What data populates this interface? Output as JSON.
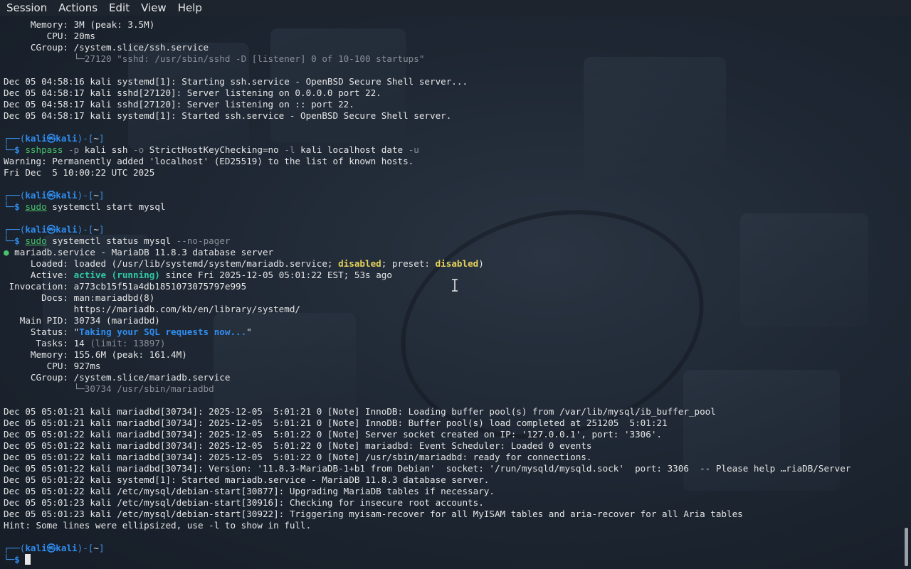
{
  "menu": [
    "Session",
    "Actions",
    "Edit",
    "View",
    "Help"
  ],
  "prompt": {
    "open": "┌──(",
    "user": "kali",
    "at": "㉿",
    "host": "kali",
    "mid": ")-[",
    "dir": "~",
    "close": "]",
    "arrow": "└─",
    "dollar": "$ "
  },
  "lines": [
    {
      "t": "     Memory: 3M (peak: 3.5M)"
    },
    {
      "t": "        CPU: 20ms"
    },
    {
      "t": "     CGroup: /system.slice/ssh.service"
    },
    {
      "t": "             └─27120 \"sshd: /usr/sbin/sshd -D [listener] 0 of 10-100 startups\"",
      "cls": "gray",
      "pre": "             └─"
    },
    {
      "t": ""
    },
    {
      "t": "Dec 05 04:58:16 kali systemd[1]: Starting ssh.service - OpenBSD Secure Shell server..."
    },
    {
      "t": "Dec 05 04:58:17 kali sshd[27120]: Server listening on 0.0.0.0 port 22."
    },
    {
      "t": "Dec 05 04:58:17 kali sshd[27120]: Server listening on :: port 22."
    },
    {
      "t": "Dec 05 04:58:17 kali systemd[1]: Started ssh.service - OpenBSD Secure Shell server."
    },
    {
      "t": ""
    },
    {
      "prompt": true
    },
    {
      "cmd": [
        "sshpass",
        "-p",
        " kali ssh ",
        "-o",
        " StrictHostKeyChecking=no ",
        "-l",
        " kali localhost date ",
        "-u"
      ]
    },
    {
      "t": "Warning: Permanently added 'localhost' (ED25519) to the list of known hosts."
    },
    {
      "t": "Fri Dec  5 10:00:22 UTC 2025"
    },
    {
      "t": ""
    },
    {
      "prompt": true
    },
    {
      "cmd2": [
        "sudo",
        " systemctl start mysql"
      ]
    },
    {
      "t": ""
    },
    {
      "prompt": true
    },
    {
      "cmd3": [
        "sudo",
        " systemctl status mysql ",
        "--no-pager"
      ]
    },
    {
      "unit": [
        "●",
        " mariadb.service - MariaDB 11.8.3 database server"
      ]
    },
    {
      "loaded": [
        "     Loaded: loaded (/usr/lib/systemd/system/mariadb.service; ",
        "disabled",
        "; preset: ",
        "disabled",
        ")"
      ]
    },
    {
      "active": [
        "     Active: ",
        "active (running)",
        " since Fri 2025-12-05 05:01:22 EST; 53s ago"
      ]
    },
    {
      "t": " Invocation: a773cb15f51a4db1851073075797e995"
    },
    {
      "t": "       Docs: man:mariadbd(8)"
    },
    {
      "t": "             https://mariadb.com/kb/en/library/systemd/"
    },
    {
      "t": "   Main PID: 30734 (mariadbd)"
    },
    {
      "status": [
        "     Status: \"",
        "Taking your SQL requests now...",
        "\""
      ]
    },
    {
      "tasks": [
        "      Tasks: 14 ",
        "(limit: 13897)"
      ]
    },
    {
      "t": "     Memory: 155.6M (peak: 161.4M)"
    },
    {
      "t": "        CPU: 927ms"
    },
    {
      "t": "     CGroup: /system.slice/mariadb.service"
    },
    {
      "tree": [
        "             ",
        "└─30734 /usr/sbin/mariadbd"
      ]
    },
    {
      "t": ""
    },
    {
      "t": "Dec 05 05:01:21 kali mariadbd[30734]: 2025-12-05  5:01:21 0 [Note] InnoDB: Loading buffer pool(s) from /var/lib/mysql/ib_buffer_pool"
    },
    {
      "t": "Dec 05 05:01:21 kali mariadbd[30734]: 2025-12-05  5:01:21 0 [Note] InnoDB: Buffer pool(s) load completed at 251205  5:01:21"
    },
    {
      "t": "Dec 05 05:01:22 kali mariadbd[30734]: 2025-12-05  5:01:22 0 [Note] Server socket created on IP: '127.0.0.1', port: '3306'."
    },
    {
      "t": "Dec 05 05:01:22 kali mariadbd[30734]: 2025-12-05  5:01:22 0 [Note] mariadbd: Event Scheduler: Loaded 0 events"
    },
    {
      "t": "Dec 05 05:01:22 kali mariadbd[30734]: 2025-12-05  5:01:22 0 [Note] /usr/sbin/mariadbd: ready for connections."
    },
    {
      "t": "Dec 05 05:01:22 kali mariadbd[30734]: Version: '11.8.3-MariaDB-1+b1 from Debian'  socket: '/run/mysqld/mysqld.sock'  port: 3306  -- Please help …riaDB/Server"
    },
    {
      "t": "Dec 05 05:01:22 kali systemd[1]: Started mariadb.service - MariaDB 11.8.3 database server."
    },
    {
      "t": "Dec 05 05:01:22 kali /etc/mysql/debian-start[30877]: Upgrading MariaDB tables if necessary."
    },
    {
      "t": "Dec 05 05:01:23 kali /etc/mysql/debian-start[30916]: Checking for insecure root accounts."
    },
    {
      "t": "Dec 05 05:01:23 kali /etc/mysql/debian-start[30922]: Triggering myisam-recover for all MyISAM tables and aria-recover for all Aria tables"
    },
    {
      "t": "Hint: Some lines were ellipsized, use -l to show in full."
    },
    {
      "t": ""
    },
    {
      "prompt": true
    },
    {
      "final": true
    }
  ],
  "colors": {
    "prompt": "#3d8ee6",
    "accent": "#2f8df0",
    "ok": "#2ec8a6",
    "warn": "#e6d35a"
  }
}
